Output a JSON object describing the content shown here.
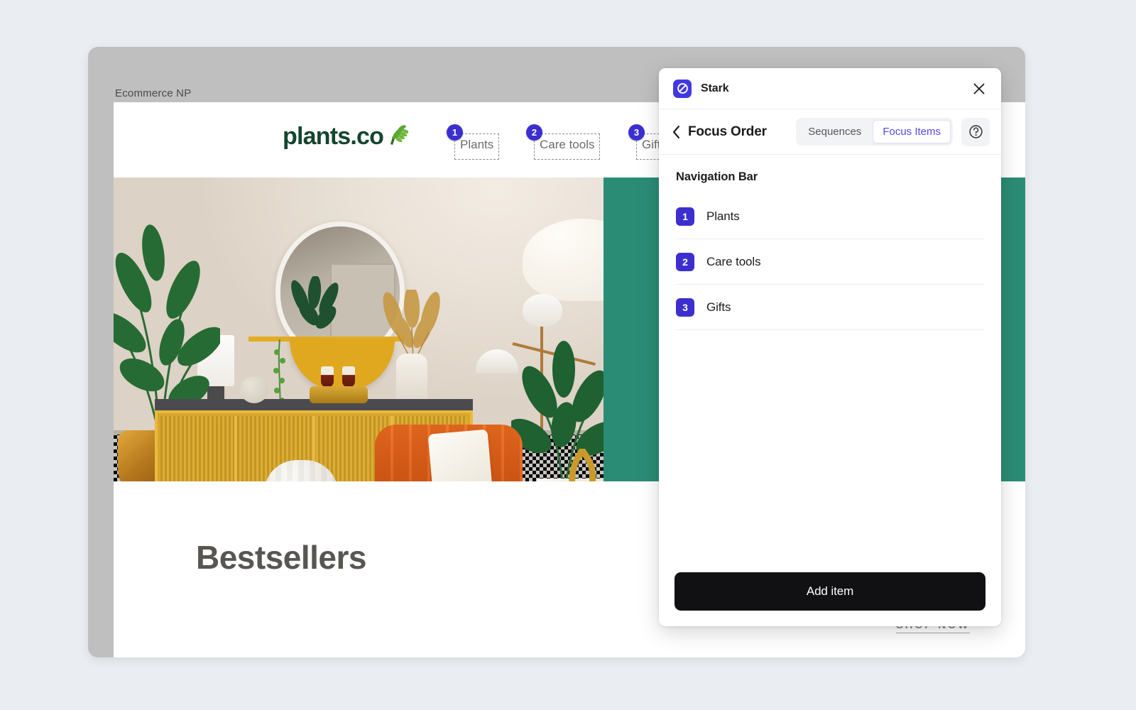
{
  "page": {
    "background_color": "#eaeef2"
  },
  "design_window": {
    "frame_label": "Ecommerce  NP",
    "frame_color": "#bfbfbf"
  },
  "website": {
    "brand": {
      "wordmark": "plants.co",
      "leaf_icon": "leaf-icon",
      "wordmark_color": "#14452f",
      "leaf_color": "#4f9b2e"
    },
    "nav_focus_markers": [
      {
        "number": "1",
        "label": "Plants"
      },
      {
        "number": "2",
        "label": "Care tools"
      },
      {
        "number": "3",
        "label": "Gifts"
      }
    ],
    "hero": {
      "accent_color": "#2b8c76",
      "photo_alt": "styled living room with tropical plants, gold sideboard, round mirror and orange armchair"
    },
    "bestsellers": {
      "title": "Bestsellers",
      "cta": "SHOP NOW"
    }
  },
  "stark_panel": {
    "titlebar": {
      "logo_icon": "stark-logo-icon",
      "app_name": "Stark",
      "close_icon": "close-icon"
    },
    "toolbar": {
      "back_icon": "chevron-left-icon",
      "title": "Focus Order",
      "segments": [
        {
          "label": "Sequences",
          "active": false
        },
        {
          "label": "Focus Items",
          "active": true
        }
      ],
      "help_icon": "help-circle-icon"
    },
    "focus_items": {
      "group_heading": "Navigation Bar",
      "rows": [
        {
          "number": "1",
          "label": "Plants"
        },
        {
          "number": "2",
          "label": "Care tools"
        },
        {
          "number": "3",
          "label": "Gifts"
        }
      ]
    },
    "footer": {
      "add_item_label": "Add item"
    },
    "colors": {
      "brand_indigo": "#4338e0",
      "badge_indigo": "#3b2fd0",
      "active_segment_text": "#5347f0",
      "footer_button": "#111113"
    }
  }
}
